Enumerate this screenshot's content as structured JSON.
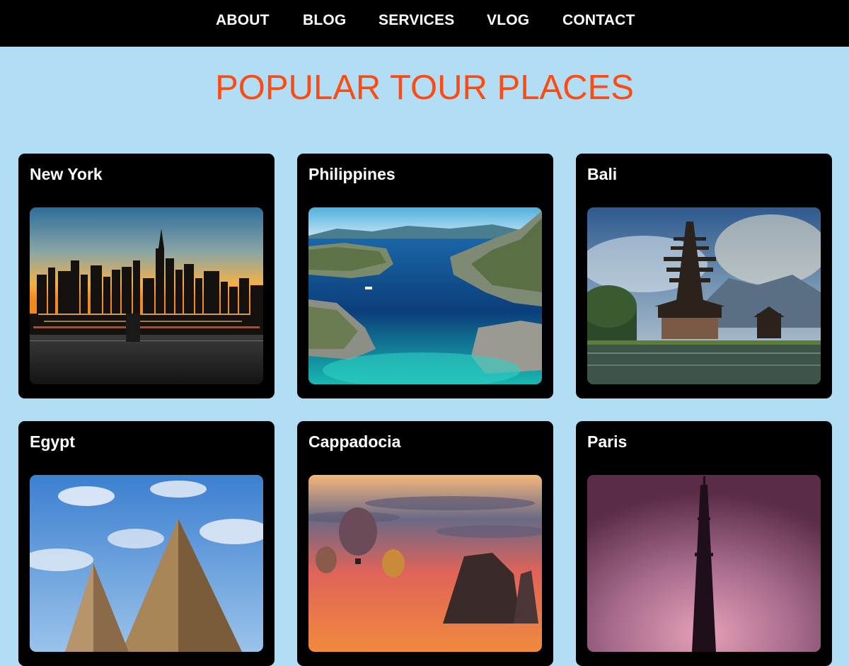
{
  "nav": {
    "items": [
      {
        "label": "ABOUT"
      },
      {
        "label": "BLOG"
      },
      {
        "label": "SERVICES"
      },
      {
        "label": "VLOG"
      },
      {
        "label": "CONTACT"
      }
    ]
  },
  "page": {
    "title": "POPULAR TOUR PLACES"
  },
  "cards": [
    {
      "title": "New York",
      "image": "city-skyline-sunset"
    },
    {
      "title": "Philippines",
      "image": "tropical-lagoon"
    },
    {
      "title": "Bali",
      "image": "pagoda-temple-lake"
    },
    {
      "title": "Egypt",
      "image": "pyramids-sky"
    },
    {
      "title": "Cappadocia",
      "image": "hot-air-balloons-sunset"
    },
    {
      "title": "Paris",
      "image": "eiffel-tower-pink-sky"
    }
  ]
}
